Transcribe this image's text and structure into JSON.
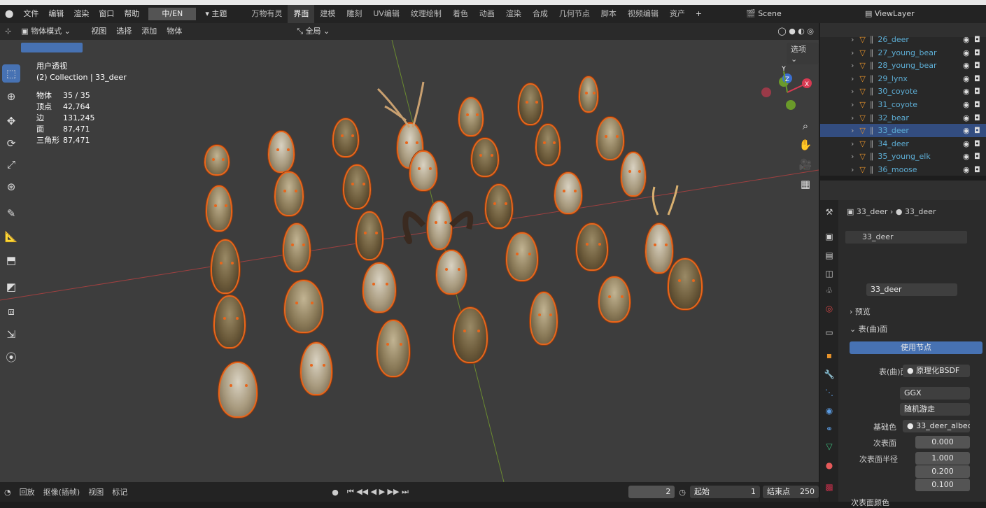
{
  "menu": {
    "blender_icon": "blender-icon",
    "items": [
      "文件",
      "编辑",
      "渲染",
      "窗口",
      "帮助"
    ],
    "lang": "中/EN",
    "theme": "主题"
  },
  "workspaces": [
    {
      "label": "万物有灵",
      "active": false
    },
    {
      "label": "界面",
      "active": true
    },
    {
      "label": "建模",
      "active": false
    },
    {
      "label": "雕刻",
      "active": false
    },
    {
      "label": "UV编辑",
      "active": false
    },
    {
      "label": "纹理绘制",
      "active": false
    },
    {
      "label": "着色",
      "active": false
    },
    {
      "label": "动画",
      "active": false
    },
    {
      "label": "渲染",
      "active": false
    },
    {
      "label": "合成",
      "active": false
    },
    {
      "label": "几何节点",
      "active": false
    },
    {
      "label": "脚本",
      "active": false
    },
    {
      "label": "视频编辑",
      "active": false
    },
    {
      "label": "资产",
      "active": false
    }
  ],
  "add_workspace": "+",
  "scene": "Scene",
  "viewlayer": "ViewLayer",
  "viewport_header": {
    "mode": "物体模式",
    "menus": [
      "视图",
      "选择",
      "添加",
      "物体"
    ],
    "transform": "全局",
    "options": "选项"
  },
  "overlay_text": {
    "view": "用户透视",
    "collection": "(2) Collection | 33_deer"
  },
  "stats": [
    {
      "label": "物体",
      "value": "35 / 35"
    },
    {
      "label": "顶点",
      "value": "42,764"
    },
    {
      "label": "边",
      "value": "131,245"
    },
    {
      "label": "面",
      "value": "87,471"
    },
    {
      "label": "三角形",
      "value": "87,471"
    }
  ],
  "gizmo": {
    "x": "X",
    "y": "Y",
    "z": "Z"
  },
  "outliner": [
    {
      "name": "26_deer",
      "selected": false
    },
    {
      "name": "27_young_bear",
      "selected": false
    },
    {
      "name": "28_young_bear",
      "selected": false
    },
    {
      "name": "29_lynx",
      "selected": false
    },
    {
      "name": "30_coyote",
      "selected": false
    },
    {
      "name": "31_coyote",
      "selected": false
    },
    {
      "name": "32_bear",
      "selected": false
    },
    {
      "name": "33_deer",
      "selected": true
    },
    {
      "name": "34_deer",
      "selected": false
    },
    {
      "name": "35_young_elk",
      "selected": false
    },
    {
      "name": "36_moose",
      "selected": false
    }
  ],
  "props": {
    "breadcrumb_object": "33_deer",
    "breadcrumb_material": "33_deer",
    "slot": "33_deer",
    "material_name": "33_deer",
    "preview": "预览",
    "surface_panel": "表(曲)面",
    "use_nodes": "使用节点",
    "surface_label": "表(曲)面",
    "surface_value": "原理化BSDF",
    "distribution": "GGX",
    "sss_method": "随机游走",
    "base_color_label": "基础色",
    "base_color_value": "33_deer_albed...",
    "subsurface_label": "次表面",
    "subsurface_value": "0.000",
    "radius_label": "次表面半径",
    "radius_values": [
      "1.000",
      "0.200",
      "0.100"
    ],
    "sss_color_label": "次表面颜色"
  },
  "timeline": {
    "playback": "回放",
    "keying": "抠像(插帧)",
    "view": "视图",
    "marker": "标记",
    "current": "2",
    "start_label": "起始",
    "start": "1",
    "end_label": "结束点",
    "end": "250"
  },
  "colors": {
    "accent": "#4772b3",
    "selection_outline": "#e8661c",
    "outliner_name": "#5dadd4"
  }
}
